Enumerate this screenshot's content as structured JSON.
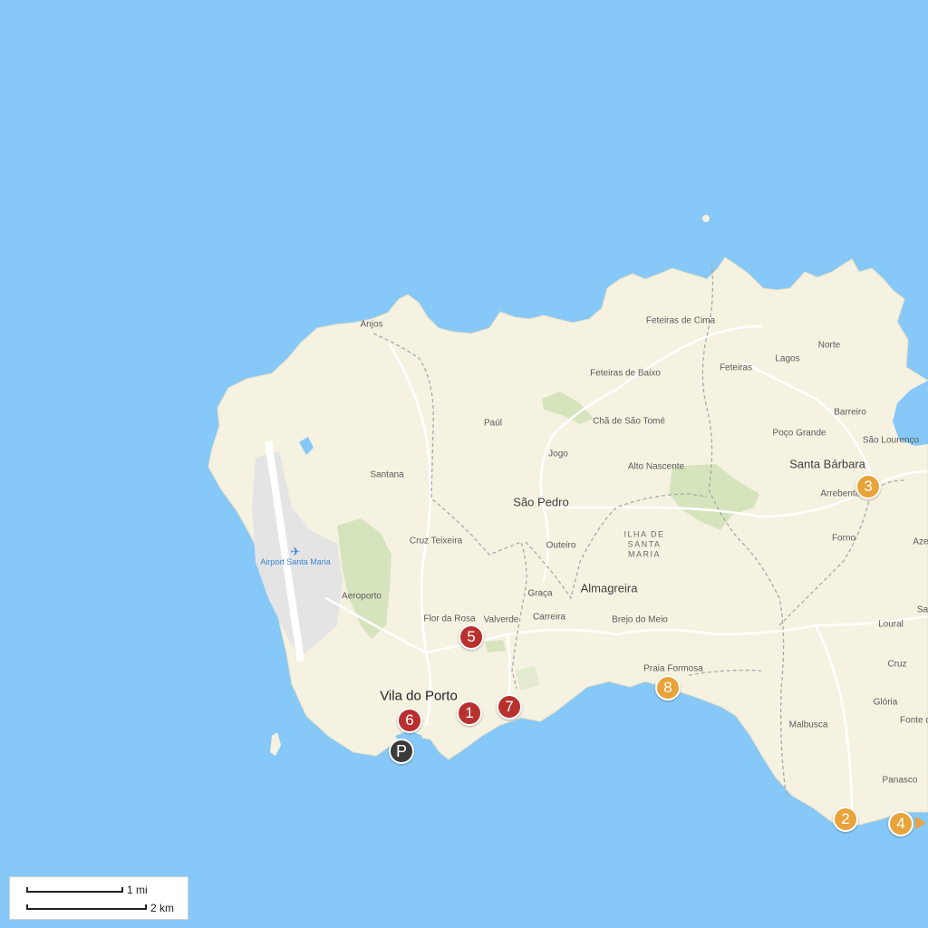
{
  "colors": {
    "sea": "#86c8f7",
    "land": "#f6f2e2",
    "park": "#d6e4bd",
    "airport_area": "#e4e4e4",
    "marker_red": "#b8312f",
    "marker_orange": "#e8a33a",
    "marker_dark": "#3b3b3b"
  },
  "places": {
    "anjos": "Anjos",
    "feteiras_de_cima": "Feteiras de Cima",
    "norte": "Norte",
    "lagos": "Lagos",
    "feteiras": "Feteiras",
    "feteiras_de_baixo": "Feteiras de Baixo",
    "barreiro": "Barreiro",
    "paul": "Paúl",
    "cha_de_sao_tome": "Chã de São Tomé",
    "poco_grande": "Poço Grande",
    "sao_lourenco": "São Lourenço",
    "jogo": "Jogo",
    "santana": "Santana",
    "alto_nascente": "Alto Nascente",
    "santa_barbara": "Santa Bárbara",
    "arrebentao": "Arrebentão",
    "sao_pedro": "São Pedro",
    "cruz_teixeira": "Cruz Teixeira",
    "outeiro": "Outeiro",
    "ilha": "ILHA DE\nSANTA\nMARIA",
    "forno": "Forno",
    "aze": "Aze",
    "airport": "Airport Santa Maria",
    "almagreira": "Almagreira",
    "graca": "Graça",
    "aeroporto": "Aeroporto",
    "flor_da_rosa": "Flor da Rosa",
    "valverde": "Valverde",
    "carreira": "Carreira",
    "brejo_do_meio": "Brejo do Meio",
    "sa": "Sa",
    "loural": "Loural",
    "praia_formosa": "Praia Formosa",
    "cruz": "Cruz",
    "vila_do_porto": "Vila do Porto",
    "gloria": "Glória",
    "fonte": "Fonte d",
    "malbusca": "Malbusca",
    "panasco": "Panasco"
  },
  "markers": {
    "m1": "1",
    "m2": "2",
    "m3": "3",
    "m4": "4",
    "m5": "5",
    "m6": "6",
    "m7": "7",
    "m8": "8",
    "parking": "P"
  },
  "scale": {
    "mi": "1 mi",
    "km": "2 km"
  },
  "icons": {
    "airport": "airplane-icon",
    "parking": "parking-icon",
    "next": "next-arrow-icon"
  }
}
